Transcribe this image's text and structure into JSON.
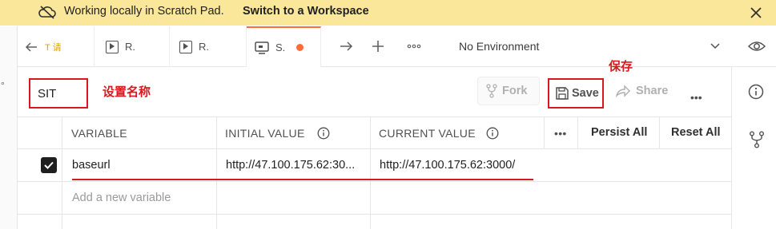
{
  "banner": {
    "message": "Working locally in Scratch Pad.",
    "link": "Switch to a Workspace"
  },
  "tabs": [
    {
      "label": "T 请",
      "icon": "arrow-left-icon"
    },
    {
      "label": "R.",
      "icon": "play-box-icon"
    },
    {
      "label": "R.",
      "icon": "play-box-icon"
    },
    {
      "label": "S.",
      "icon": "environment-icon",
      "active": true,
      "unsaved": true
    }
  ],
  "environment_selector": {
    "value": "No Environment"
  },
  "env_editor": {
    "name": "SIT",
    "fork_label": "Fork",
    "save_label": "Save",
    "share_label": "Share",
    "more_label": "•••"
  },
  "annotations": {
    "name_note": "设置名称",
    "save_note": "保存"
  },
  "table": {
    "headers": {
      "variable": "VARIABLE",
      "initial_value": "INITIAL VALUE",
      "current_value": "CURRENT VALUE",
      "more": "•••",
      "persist_all": "Persist All",
      "reset_all": "Reset All"
    },
    "rows": [
      {
        "enabled": true,
        "variable": "baseurl",
        "initial_value": "http://47.100.175.62:30...",
        "current_value": "http://47.100.175.62:3000/"
      }
    ],
    "new_row_placeholder": "Add a new variable"
  },
  "colors": {
    "banner_bg": "#fbe79a",
    "accent": "#ff6c37",
    "annotation_red": "#d8191f"
  }
}
